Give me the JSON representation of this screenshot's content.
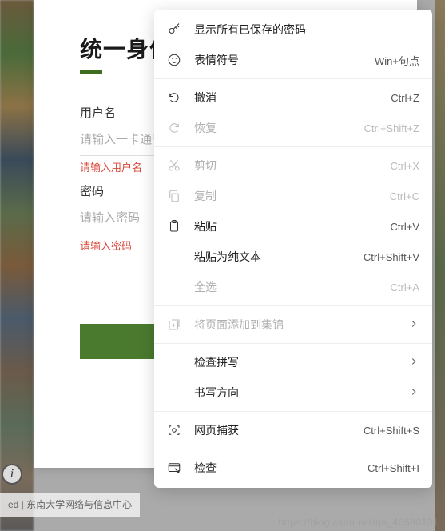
{
  "login": {
    "title": "统一身份认",
    "username_label": "用户名",
    "username_placeholder": "请输入一卡通号",
    "username_error": "请输入用户名",
    "password_label": "密码",
    "password_placeholder": "请输入密码",
    "password_error": "请输入密码"
  },
  "footer": {
    "text": "ed | 东南大学网络与信息中心"
  },
  "watermark": "https://blog.csdn.net/qn_40580131",
  "context_menu": {
    "items": [
      {
        "icon": "key-icon",
        "label": "显示所有已保存的密码",
        "shortcut": "",
        "enabled": true,
        "submenu": false
      },
      {
        "icon": "emoji-icon",
        "label": "表情符号",
        "shortcut": "Win+句点",
        "enabled": true,
        "submenu": false
      },
      {
        "sep": true
      },
      {
        "icon": "undo-icon",
        "label": "撤消",
        "shortcut": "Ctrl+Z",
        "enabled": true,
        "submenu": false
      },
      {
        "icon": "redo-icon",
        "label": "恢复",
        "shortcut": "Ctrl+Shift+Z",
        "enabled": false,
        "submenu": false
      },
      {
        "sep": true
      },
      {
        "icon": "cut-icon",
        "label": "剪切",
        "shortcut": "Ctrl+X",
        "enabled": false,
        "submenu": false
      },
      {
        "icon": "copy-icon",
        "label": "复制",
        "shortcut": "Ctrl+C",
        "enabled": false,
        "submenu": false
      },
      {
        "icon": "paste-icon",
        "label": "粘贴",
        "shortcut": "Ctrl+V",
        "enabled": true,
        "submenu": false
      },
      {
        "icon": "",
        "label": "粘贴为纯文本",
        "shortcut": "Ctrl+Shift+V",
        "enabled": true,
        "submenu": false
      },
      {
        "icon": "",
        "label": "全选",
        "shortcut": "Ctrl+A",
        "enabled": false,
        "submenu": false
      },
      {
        "sep": true
      },
      {
        "icon": "collections-icon",
        "label": "将页面添加到集锦",
        "shortcut": "",
        "enabled": false,
        "submenu": true
      },
      {
        "sep": true
      },
      {
        "icon": "",
        "label": "检查拼写",
        "shortcut": "",
        "enabled": true,
        "submenu": true
      },
      {
        "icon": "",
        "label": "书写方向",
        "shortcut": "",
        "enabled": true,
        "submenu": true
      },
      {
        "sep": true
      },
      {
        "icon": "capture-icon",
        "label": "网页捕获",
        "shortcut": "Ctrl+Shift+S",
        "enabled": true,
        "submenu": false
      },
      {
        "sep": true
      },
      {
        "icon": "inspect-icon",
        "label": "检查",
        "shortcut": "Ctrl+Shift+I",
        "enabled": true,
        "submenu": false
      }
    ]
  }
}
